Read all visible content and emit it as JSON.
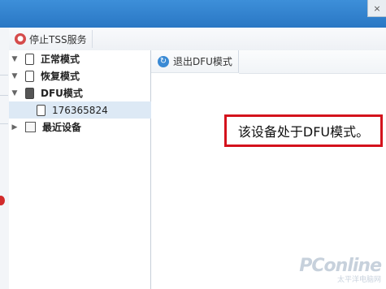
{
  "window": {
    "close_glyph": "×"
  },
  "toolbar": {
    "stop_tss_label": "停止TSS服务",
    "stop_tss_icon": "stop-tss-icon"
  },
  "tree": {
    "items": [
      {
        "label": "正常模式",
        "icon": "device-icon",
        "expanded": false
      },
      {
        "label": "恢复模式",
        "icon": "recovery-icon",
        "expanded": false
      },
      {
        "label": "DFU模式",
        "icon": "dfu-device-icon",
        "expanded": true
      },
      {
        "label": "176365824",
        "icon": "device-icon",
        "child": true,
        "selected": true
      },
      {
        "label": "最近设备",
        "icon": "folder-icon",
        "expanded": false
      }
    ]
  },
  "content": {
    "exit_dfu_label": "退出DFU模式",
    "message": "该设备处于DFU模式。"
  },
  "watermark": {
    "logo": "PConline",
    "sub": "太平洋电脑网"
  },
  "colors": {
    "titlebar": "#2f7fcf",
    "highlight_border": "#d4121c",
    "selection": "#dde9f5"
  }
}
